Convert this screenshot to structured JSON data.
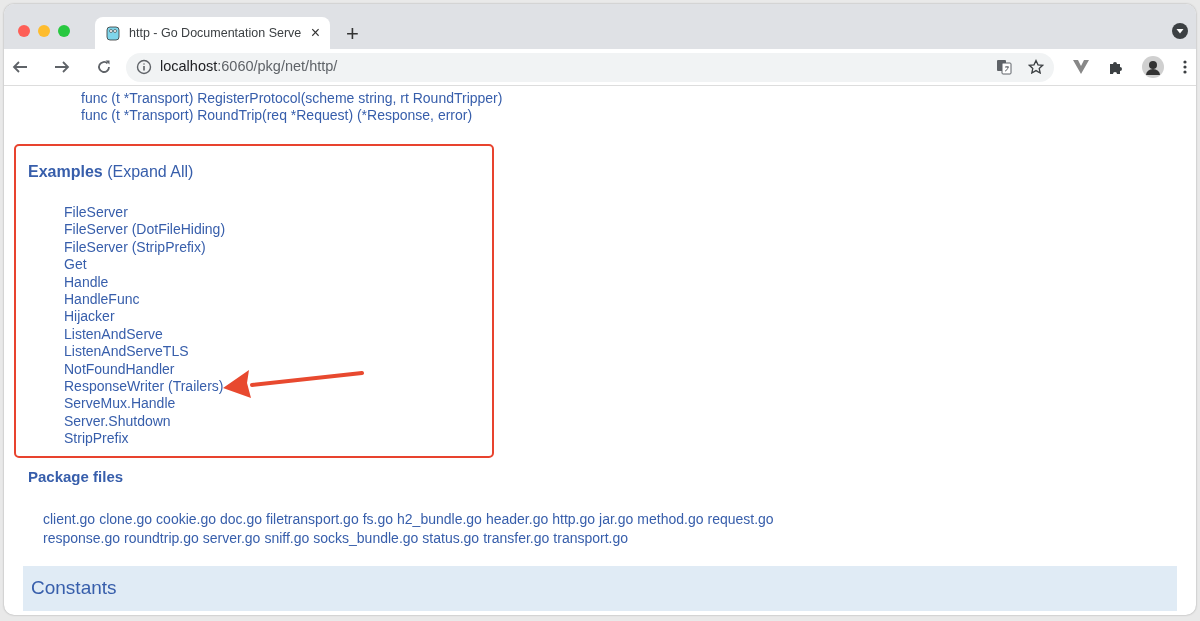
{
  "browser": {
    "tab": {
      "title": "http - Go Documentation Serve",
      "close": "×"
    },
    "new_tab": "+",
    "address": {
      "host": "localhost",
      "path": ":6060/pkg/net/http/"
    }
  },
  "methods": [
    "func (t *Transport) RegisterProtocol(scheme string, rt RoundTripper)",
    "func (t *Transport) RoundTrip(req *Request) (*Response, error)"
  ],
  "examples": {
    "title": "Examples",
    "toggle": "(Expand All)",
    "items": [
      "FileServer",
      "FileServer (DotFileHiding)",
      "FileServer (StripPrefix)",
      "Get",
      "Handle",
      "HandleFunc",
      "Hijacker",
      "ListenAndServe",
      "ListenAndServeTLS",
      "NotFoundHandler",
      "ResponseWriter (Trailers)",
      "ServeMux.Handle",
      "Server.Shutdown",
      "StripPrefix"
    ]
  },
  "package_files": {
    "title": "Package files",
    "files": [
      "client.go",
      "clone.go",
      "cookie.go",
      "doc.go",
      "filetransport.go",
      "fs.go",
      "h2_bundle.go",
      "header.go",
      "http.go",
      "jar.go",
      "method.go",
      "request.go",
      "response.go",
      "roundtrip.go",
      "server.go",
      "sniff.go",
      "socks_bundle.go",
      "status.go",
      "transfer.go",
      "transport.go"
    ]
  },
  "section": {
    "title": "Constants"
  }
}
